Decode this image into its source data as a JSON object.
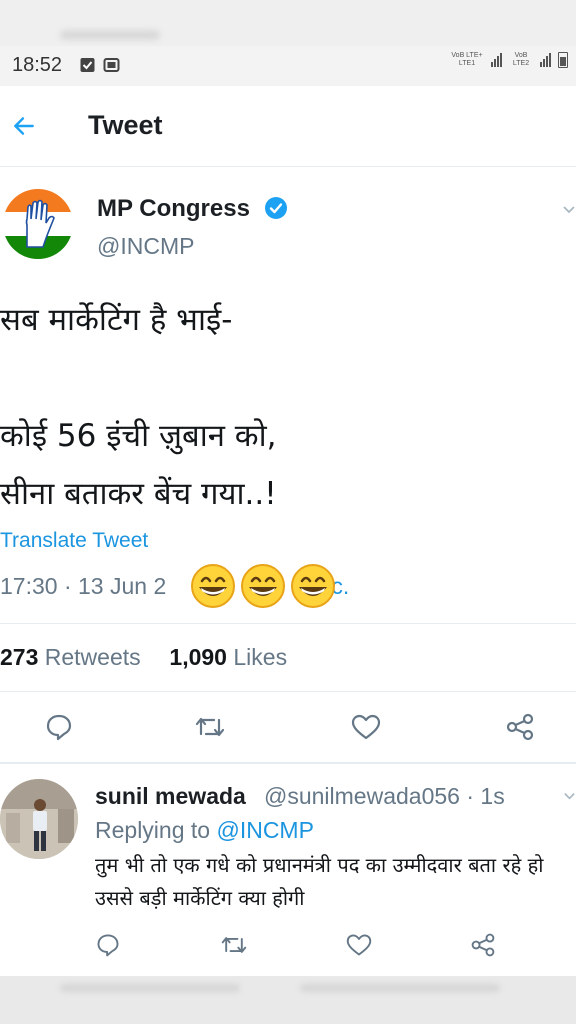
{
  "status_bar": {
    "time": "18:52",
    "network_1": "VoB LTE+ LTE1",
    "network_2": "VoB LTE2"
  },
  "header": {
    "title": "Tweet"
  },
  "tweet": {
    "author_name": "MP Congress",
    "author_handle": "@INCMP",
    "text": "सब मार्केटिंग है भाई-\n\nकोई 56 इंची ज़ुबान को,\nसीना बताकर बेंच गया..!",
    "translate_label": "Translate Tweet",
    "timestamp_prefix": "17:30 · 13 Jun 2",
    "timestamp_suffix": "Inc.",
    "retweets_count": "273",
    "retweets_label": "Retweets",
    "likes_count": "1,090",
    "likes_label": "Likes"
  },
  "reply": {
    "author_name": "sunil mewada",
    "author_handle": "@sunilmewada056 · 1s",
    "replying_label": "Replying to",
    "replying_to": "@INCMP",
    "text": "तुम भी तो एक गधे को प्रधानमंत्री पद का उम्मीदवार बता रहे हो उससे बड़ी मार्केटिंग क्या होगी"
  },
  "colors": {
    "link_blue": "#1b95e0",
    "secondary_text": "#657786",
    "icon_gray": "#657786",
    "verified_blue": "#1da1f2",
    "congress_saffron": "#f47a20",
    "congress_green": "#138808"
  },
  "icons": {
    "back": "arrow-left-icon",
    "verified": "verified-badge-icon",
    "caret": "chevron-down-icon",
    "reply": "comment-icon",
    "retweet": "retweet-icon",
    "like": "heart-icon",
    "share": "share-icon",
    "overlay": "grinning-emoji"
  }
}
